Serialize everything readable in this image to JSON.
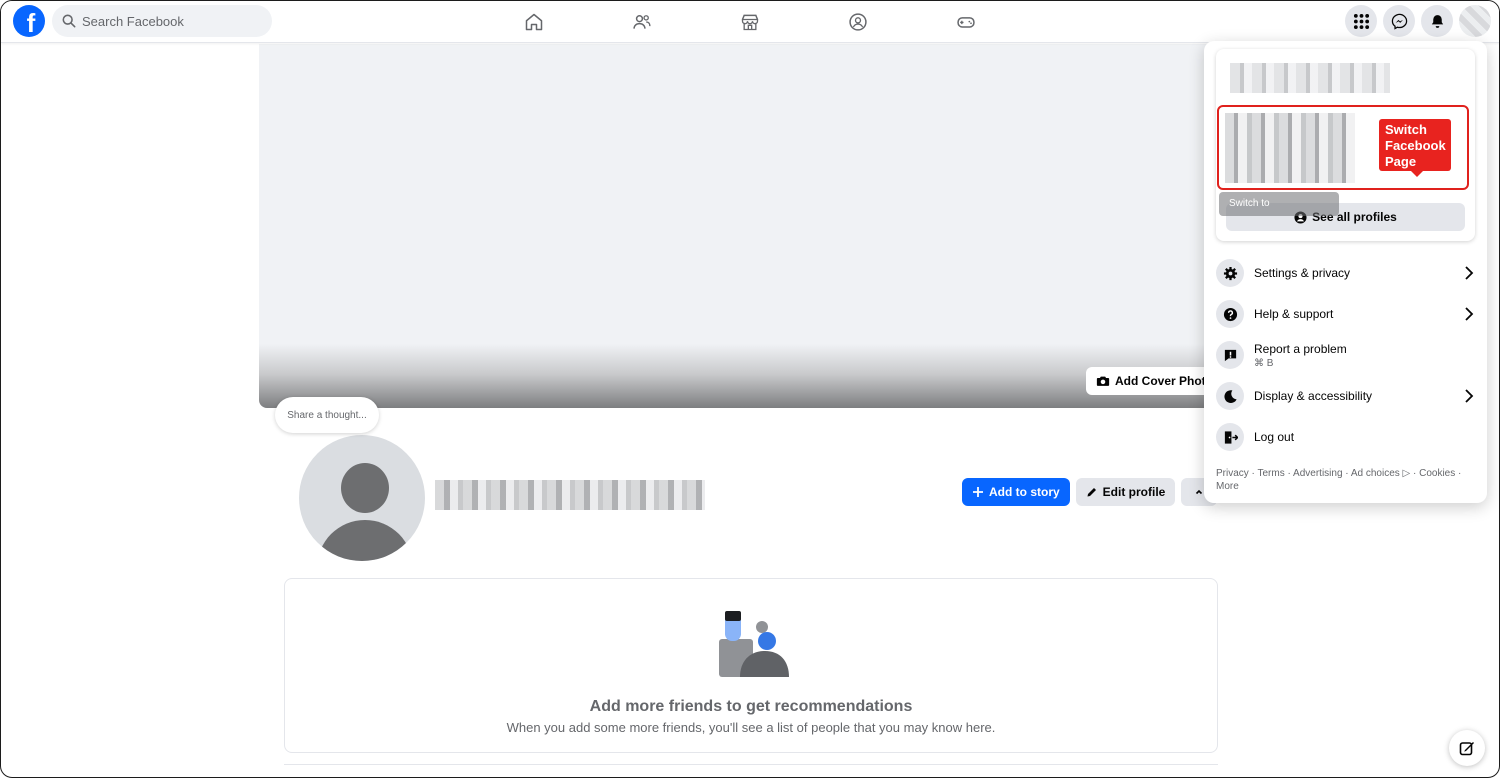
{
  "nav": {
    "logo_letter": "f",
    "search_placeholder": "Search Facebook",
    "icons": [
      "home-icon",
      "friends-icon",
      "marketplace-icon",
      "groups-icon",
      "gaming-icon"
    ],
    "right_icons": [
      "menu-grid-icon",
      "messenger-icon",
      "bell-icon"
    ]
  },
  "cover": {
    "add_cover_label": "Add Cover Photo"
  },
  "profile": {
    "thought_placeholder": "Share a thought...",
    "add_story_label": "Add to story",
    "edit_profile_label": "Edit profile"
  },
  "recommendations": {
    "title": "Add more friends to get recommendations",
    "subtitle": "When you add some more friends, you'll see a list of people that you may know here."
  },
  "menu": {
    "callout": "Switch Facebook Page",
    "switch_tooltip": "Switch to",
    "see_all_label": "See all profiles",
    "items": [
      {
        "label": "Settings & privacy",
        "icon": "gear-icon"
      },
      {
        "label": "Help & support",
        "icon": "question-icon"
      },
      {
        "label": "Report a problem",
        "sub": "⌘ B",
        "icon": "report-icon"
      },
      {
        "label": "Display & accessibility",
        "icon": "moon-icon"
      },
      {
        "label": "Log out",
        "icon": "logout-icon"
      }
    ],
    "footer": "Privacy · Terms · Advertising · Ad choices ▷ · Cookies · More"
  },
  "colors": {
    "accent": "#0866ff",
    "callout": "#e8231f"
  }
}
